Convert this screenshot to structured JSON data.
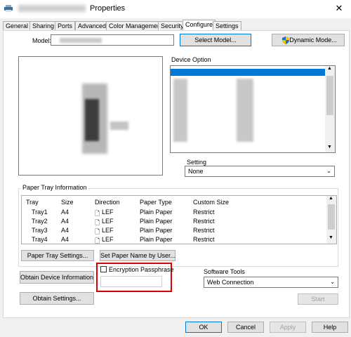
{
  "window": {
    "title": "Properties",
    "close_glyph": "✕"
  },
  "tabs": [
    "General",
    "Sharing",
    "Ports",
    "Advanced",
    "Color Management",
    "Security",
    "Configure",
    "Settings"
  ],
  "model": {
    "label": "Model:",
    "select_button": "Select Model...",
    "dynamic_button": "Dynamic Mode..."
  },
  "device_option": {
    "title": "Device Option",
    "setting_label": "Setting",
    "setting_value": "None"
  },
  "paper_tray": {
    "title": "Paper Tray Information",
    "headers": [
      "Tray",
      "Size",
      "Direction",
      "Paper Type",
      "Custom Size"
    ],
    "rows": [
      {
        "tray": "Tray1",
        "size": "A4",
        "direction": "LEF",
        "type": "Plain Paper",
        "custom": "Restrict"
      },
      {
        "tray": "Tray2",
        "size": "A4",
        "direction": "LEF",
        "type": "Plain Paper",
        "custom": "Restrict"
      },
      {
        "tray": "Tray3",
        "size": "A4",
        "direction": "LEF",
        "type": "Plain Paper",
        "custom": "Restrict"
      },
      {
        "tray": "Tray4",
        "size": "A4",
        "direction": "LEF",
        "type": "Plain Paper",
        "custom": "Restrict"
      }
    ],
    "settings_button": "Paper Tray Settings...",
    "set_name_button": "Set Paper Name by User..."
  },
  "obtain": {
    "device_info_button": "Obtain Device Information",
    "settings_button": "Obtain Settings..."
  },
  "encryption": {
    "checkbox_label": "Encryption Passphrase",
    "checked": false
  },
  "software_tools": {
    "label": "Software Tools",
    "value": "Web Connection",
    "start_button": "Start"
  },
  "footer": {
    "ok": "OK",
    "cancel": "Cancel",
    "apply": "Apply",
    "help": "Help"
  },
  "colors": {
    "accent": "#0078d7",
    "highlight": "#e00000",
    "selection": "#0078d7"
  }
}
